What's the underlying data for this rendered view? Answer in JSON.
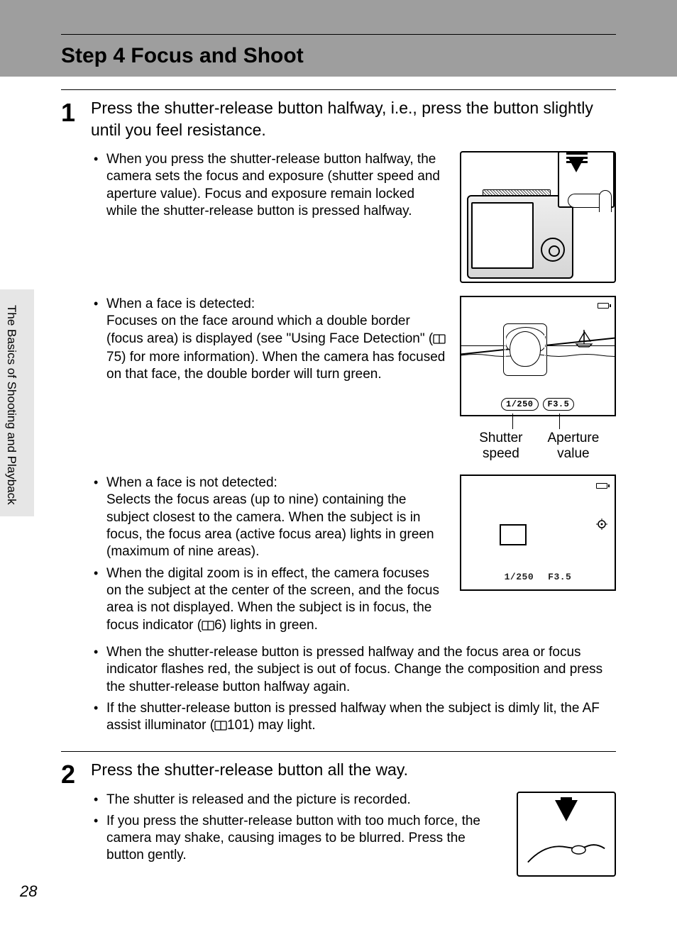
{
  "section_title": "Step 4 Focus and Shoot",
  "side_tab": "The Basics of Shooting and Playback",
  "page_number": "28",
  "step1": {
    "number": "1",
    "heading": "Press the shutter-release button halfway, i.e., press the button slightly until you feel resistance.",
    "bullet_a": "When you press the shutter-release button halfway, the camera sets the focus and exposure (shutter speed and aperture value). Focus and exposure remain locked while the shutter-release button is pressed halfway.",
    "bullet_b_lead": "When a face is detected:",
    "bullet_b_body_pre": "Focuses on the face around which a double border (focus area) is displayed (see \"Using Face Detection\" (",
    "bullet_b_ref": "75",
    "bullet_b_body_post": ") for more information). When the camera has focused on that face, the double border will turn green.",
    "bullet_c_lead": "When a face is not detected:",
    "bullet_c_body": "Selects the focus areas (up to nine) containing the subject closest to the camera. When the subject is in focus, the focus area (active focus area) lights in green (maximum of nine areas).",
    "bullet_d_pre": "When the digital zoom is in effect, the camera focuses on the subject at the center of the screen, and the focus area is not displayed. When the subject is in focus, the focus indicator (",
    "bullet_d_ref": "6",
    "bullet_d_post": ") lights in green.",
    "bullet_e": "When the shutter-release button is pressed halfway and the focus area or focus indicator flashes red, the subject is out of focus. Change the composition and press the shutter-release button halfway again.",
    "bullet_f_pre": "If the shutter-release button is pressed halfway when the subject is dimly lit, the AF assist illuminator (",
    "bullet_f_ref": "101",
    "bullet_f_post": ") may light."
  },
  "callouts": {
    "shutter_speed": "Shutter speed",
    "aperture_value": "Aperture value"
  },
  "screen1": {
    "shutter": "1/250",
    "aperture": "F3.5"
  },
  "screen2": {
    "shutter": "1/250",
    "aperture": "F3.5"
  },
  "step2": {
    "number": "2",
    "heading": "Press the shutter-release button all the way.",
    "bullet_a": "The shutter is released and the picture is recorded.",
    "bullet_b": "If you press the shutter-release button with too much force, the camera may shake, causing images to be blurred. Press the button gently."
  }
}
